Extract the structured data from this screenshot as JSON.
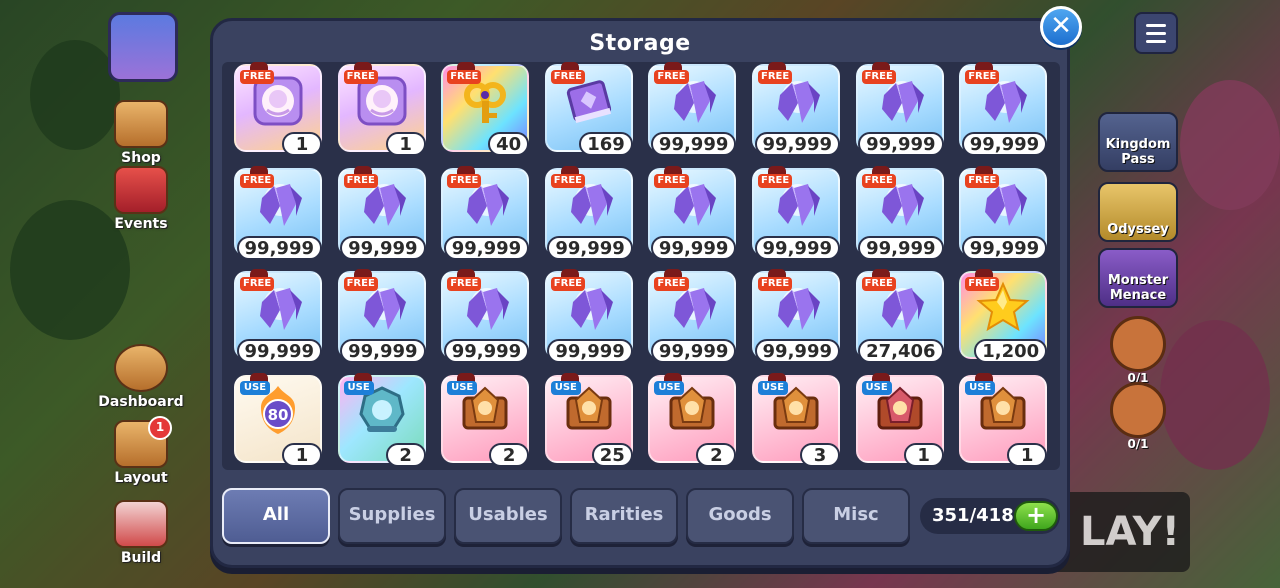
{
  "dialog": {
    "title": "Storage",
    "close_label": "✕"
  },
  "tabs": [
    {
      "label": "All",
      "active": true
    },
    {
      "label": "Supplies",
      "active": false
    },
    {
      "label": "Usables",
      "active": false
    },
    {
      "label": "Rarities",
      "active": false
    },
    {
      "label": "Goods",
      "active": false
    },
    {
      "label": "Misc",
      "active": false
    }
  ],
  "capacity": {
    "text": "351/418",
    "add_label": "+"
  },
  "items": [
    {
      "tag": "FREE",
      "qty": "1",
      "bg": "purple",
      "icon": "portrait-scroll-icon"
    },
    {
      "tag": "FREE",
      "qty": "1",
      "bg": "purple",
      "icon": "portrait-scroll-icon"
    },
    {
      "tag": "FREE",
      "qty": "40",
      "bg": "rainbow",
      "icon": "golden-key-icon"
    },
    {
      "tag": "FREE",
      "qty": "169",
      "bg": "blue",
      "icon": "purple-book-icon"
    },
    {
      "tag": "FREE",
      "qty": "99,999",
      "bg": "blue",
      "icon": "crystal-shard-icon"
    },
    {
      "tag": "FREE",
      "qty": "99,999",
      "bg": "blue",
      "icon": "crystal-shard-icon"
    },
    {
      "tag": "FREE",
      "qty": "99,999",
      "bg": "blue",
      "icon": "crystal-shard-icon"
    },
    {
      "tag": "FREE",
      "qty": "99,999",
      "bg": "blue",
      "icon": "crystal-shard-icon"
    },
    {
      "tag": "FREE",
      "qty": "99,999",
      "bg": "blue",
      "icon": "crystal-shard-icon"
    },
    {
      "tag": "FREE",
      "qty": "99,999",
      "bg": "blue",
      "icon": "crystal-shard-icon"
    },
    {
      "tag": "FREE",
      "qty": "99,999",
      "bg": "blue",
      "icon": "crystal-shard-icon"
    },
    {
      "tag": "FREE",
      "qty": "99,999",
      "bg": "blue",
      "icon": "crystal-shard-icon"
    },
    {
      "tag": "FREE",
      "qty": "99,999",
      "bg": "blue",
      "icon": "crystal-shard-icon"
    },
    {
      "tag": "FREE",
      "qty": "99,999",
      "bg": "blue",
      "icon": "crystal-shard-icon"
    },
    {
      "tag": "FREE",
      "qty": "99,999",
      "bg": "blue",
      "icon": "crystal-shard-icon"
    },
    {
      "tag": "FREE",
      "qty": "99,999",
      "bg": "blue",
      "icon": "crystal-shard-icon"
    },
    {
      "tag": "FREE",
      "qty": "99,999",
      "bg": "blue",
      "icon": "crystal-shard-icon"
    },
    {
      "tag": "FREE",
      "qty": "99,999",
      "bg": "blue",
      "icon": "crystal-shard-icon"
    },
    {
      "tag": "FREE",
      "qty": "99,999",
      "bg": "blue",
      "icon": "crystal-shard-icon"
    },
    {
      "tag": "FREE",
      "qty": "99,999",
      "bg": "blue",
      "icon": "crystal-shard-icon"
    },
    {
      "tag": "FREE",
      "qty": "99,999",
      "bg": "blue",
      "icon": "crystal-shard-icon"
    },
    {
      "tag": "FREE",
      "qty": "99,999",
      "bg": "blue",
      "icon": "crystal-shard-icon"
    },
    {
      "tag": "FREE",
      "qty": "27,406",
      "bg": "blue",
      "icon": "crystal-shard-icon"
    },
    {
      "tag": "FREE",
      "qty": "1,200",
      "bg": "rainbow",
      "icon": "gold-star-icon"
    },
    {
      "tag": "USE",
      "qty": "1",
      "bg": "cream",
      "icon": "level-badge-icon",
      "icon_text": "80"
    },
    {
      "tag": "USE",
      "qty": "2",
      "bg": "teal",
      "icon": "silver-crest-icon"
    },
    {
      "tag": "USE",
      "qty": "2",
      "bg": "pink",
      "icon": "bronze-crest-icon"
    },
    {
      "tag": "USE",
      "qty": "25",
      "bg": "pink",
      "icon": "bronze-crest-icon"
    },
    {
      "tag": "USE",
      "qty": "2",
      "bg": "pink",
      "icon": "bronze-crest-icon"
    },
    {
      "tag": "USE",
      "qty": "3",
      "bg": "pink",
      "icon": "bronze-crest-icon"
    },
    {
      "tag": "USE",
      "qty": "1",
      "bg": "pink",
      "icon": "red-crest-icon"
    },
    {
      "tag": "USE",
      "qty": "1",
      "bg": "pink",
      "icon": "bronze-crest-icon"
    }
  ],
  "background": {
    "left_menu": [
      {
        "label": "Shop"
      },
      {
        "label": "Events"
      },
      {
        "label": "Dashboard"
      },
      {
        "label": "Layout",
        "badge": "1"
      },
      {
        "label": "Build"
      }
    ],
    "right_menu": [
      {
        "label": "Kingdom Pass"
      },
      {
        "label": "Odyssey"
      },
      {
        "label": "Monster Menace"
      }
    ],
    "quests": [
      {
        "label": "0/1"
      },
      {
        "label": "0/1"
      }
    ],
    "play_label": "LAY!"
  }
}
